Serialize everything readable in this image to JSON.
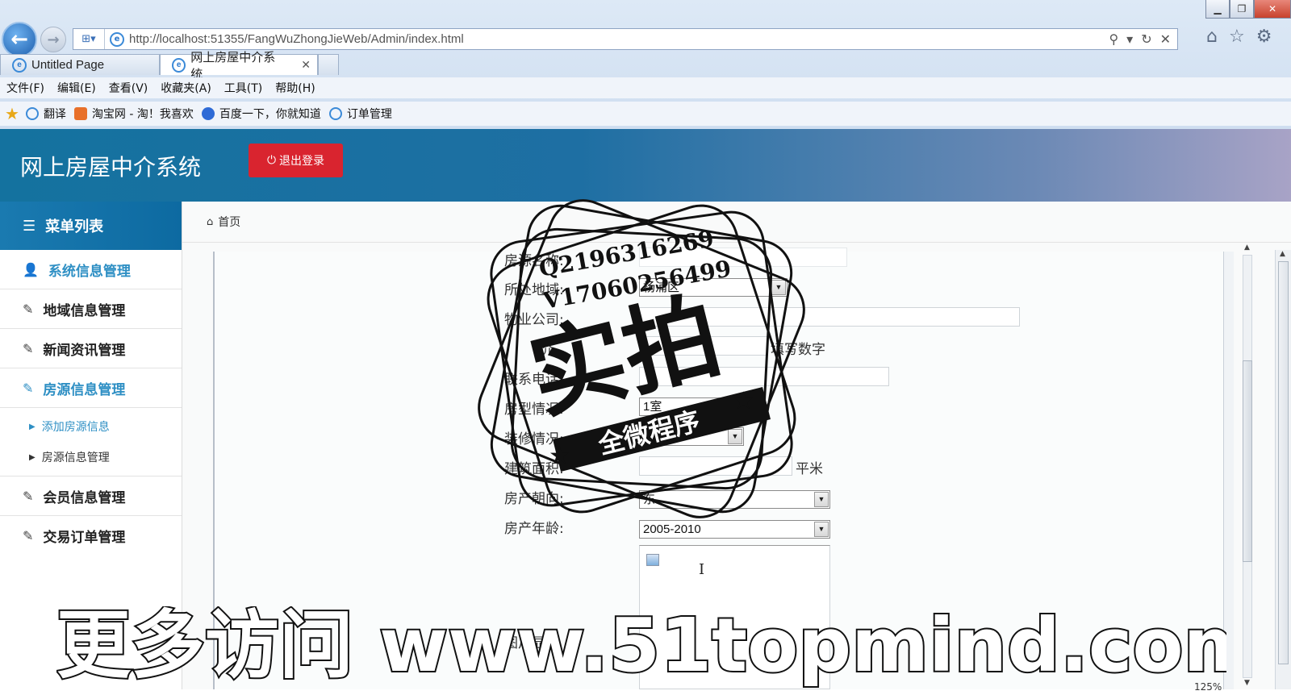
{
  "browser": {
    "url": "http://localhost:51355/FangWuZhongJieWeb/Admin/index.html",
    "tabs": [
      {
        "label": "Untitled Page"
      },
      {
        "label": "网上房屋中介系统"
      }
    ],
    "menu": [
      "文件(F)",
      "编辑(E)",
      "查看(V)",
      "收藏夹(A)",
      "工具(T)",
      "帮助(H)"
    ],
    "favorites": [
      "翻译",
      "淘宝网 - 淘！我喜欢",
      "百度一下，你就知道",
      "订单管理"
    ],
    "zoom": "125%"
  },
  "app": {
    "title": "网上房屋中介系统",
    "logout_label": "退出登录"
  },
  "sidebar": {
    "header": "菜单列表",
    "items": [
      {
        "label": "系统信息管理"
      },
      {
        "label": "地域信息管理"
      },
      {
        "label": "新闻资讯管理"
      },
      {
        "label": "房源信息管理"
      }
    ],
    "subitems": [
      {
        "label": "添加房源信息"
      },
      {
        "label": "房源信息管理"
      }
    ],
    "items_after": [
      {
        "label": "会员信息管理"
      },
      {
        "label": "交易订单管理"
      }
    ]
  },
  "breadcrumb": {
    "home": "首页"
  },
  "form": {
    "name_label": "房源名称:",
    "region_label": "所处地域:",
    "region_value": "杨浦区",
    "property_label": "物业公司:",
    "price_label": "价",
    "price_hint": "填写数字",
    "phone_label": "联系电话:",
    "layout_label": "房型情况:",
    "layout_value": "1室",
    "decor_label": "装修情况:",
    "area_label": "建筑面积:",
    "area_unit": "平米",
    "orient_label": "房产朝向:",
    "orient_value": "东",
    "age_label": "房产年龄:",
    "age_value": "2005-2010",
    "image_label": "图片显示"
  },
  "overlay": {
    "stamp_main": "实拍",
    "stamp_banner": "全微程序",
    "stamp_line1": "Q2196316269",
    "stamp_line2": "V17060256499",
    "watermark": "更多访问 www.51topmind.com"
  }
}
